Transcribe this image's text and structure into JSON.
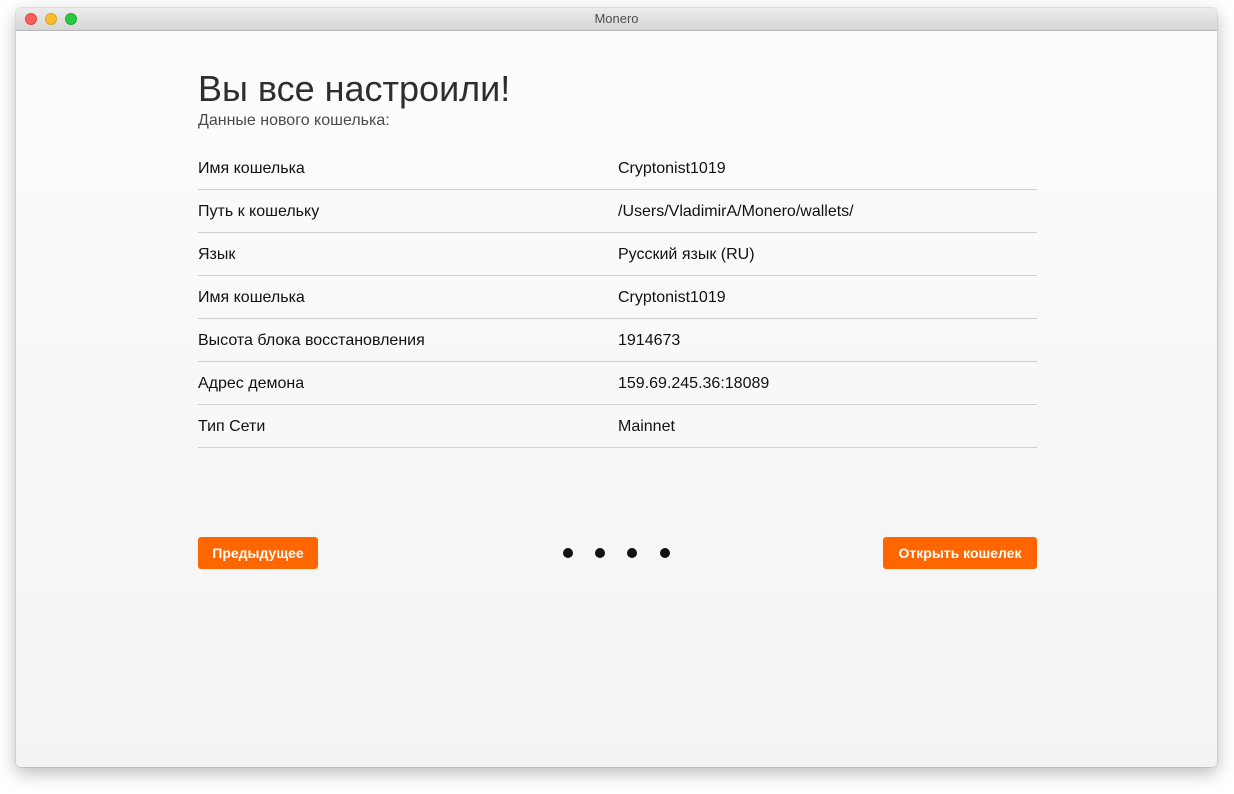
{
  "window": {
    "title": "Monero"
  },
  "page": {
    "heading": "Вы все настроили!",
    "subheading": "Данные нового кошелька:"
  },
  "details": [
    {
      "label": "Имя кошелька",
      "value": "Cryptonist1019"
    },
    {
      "label": "Путь к кошельку",
      "value": "/Users/VladimirA/Monero/wallets/"
    },
    {
      "label": "Язык",
      "value": "Русский язык (RU)"
    },
    {
      "label": "Имя кошелька",
      "value": "Cryptonist1019"
    },
    {
      "label": "Высота блока восстановления",
      "value": "1914673"
    },
    {
      "label": "Адрес демона",
      "value": "159.69.245.36:18089"
    },
    {
      "label": "Тип Сети",
      "value": "Mainnet"
    }
  ],
  "navigation": {
    "prev_label": "Предыдущее",
    "open_label": "Открыть кошелек",
    "step_count": 4
  },
  "colors": {
    "accent": "#ff6600",
    "dot": "#111111",
    "divider": "#cfcfcf"
  },
  "icons": {
    "close": "close-traffic-light-icon",
    "minimize": "minimize-traffic-light-icon",
    "maximize": "maximize-traffic-light-icon"
  }
}
